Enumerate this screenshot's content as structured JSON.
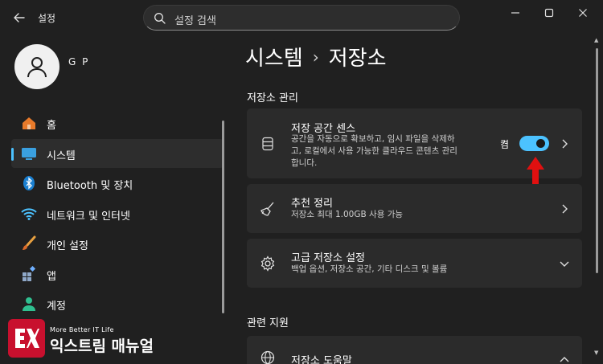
{
  "app": {
    "title": "설정"
  },
  "search": {
    "placeholder": "설정 검색"
  },
  "profile": {
    "name": "G P"
  },
  "sidebar": {
    "items": [
      {
        "label": "홈",
        "icon": "home-icon"
      },
      {
        "label": "시스템",
        "icon": "system-icon",
        "active": true
      },
      {
        "label": "Bluetooth 및 장치",
        "icon": "bluetooth-icon"
      },
      {
        "label": "네트워크 및 인터넷",
        "icon": "wifi-icon"
      },
      {
        "label": "개인 설정",
        "icon": "brush-icon"
      },
      {
        "label": "앱",
        "icon": "apps-icon"
      },
      {
        "label": "계정",
        "icon": "account-icon"
      }
    ]
  },
  "breadcrumb": {
    "parent": "시스템",
    "separator": "›",
    "current": "저장소"
  },
  "sections": {
    "storage_management": "저장소 관리",
    "related_support": "관련 지원"
  },
  "cards": [
    {
      "title": "저장 공간 센스",
      "description_lines": [
        "공간을 자동으로 확보하고, 임시 파일을 삭제하",
        "고, 로컬에서 사용 가능한 클라우드 콘텐츠 관리",
        "합니다."
      ],
      "icon": "storage-icon",
      "toggle_label": "켬",
      "toggle_on": true
    },
    {
      "title": "추천 정리",
      "description_lines": [
        "저장소 최대 1.00GB 사용 가능"
      ],
      "icon": "broom-icon"
    },
    {
      "title": "고급 저장소 설정",
      "description_lines": [
        "백업 옵션, 저장소 공간, 기타 디스크 및 볼륨"
      ],
      "icon": "gear-icon"
    },
    {
      "title": "저장소 도움말",
      "icon": "globe-icon"
    }
  ],
  "watermark": {
    "subtitle": "More Better IT Life",
    "title": "익스트림 매뉴얼",
    "logo_text": "EX"
  },
  "colors": {
    "background": "#202020",
    "card": "#2b2b2b",
    "accent": "#4cc2ff",
    "annotation_arrow": "#e01010",
    "watermark_logo": "#c8102e"
  }
}
